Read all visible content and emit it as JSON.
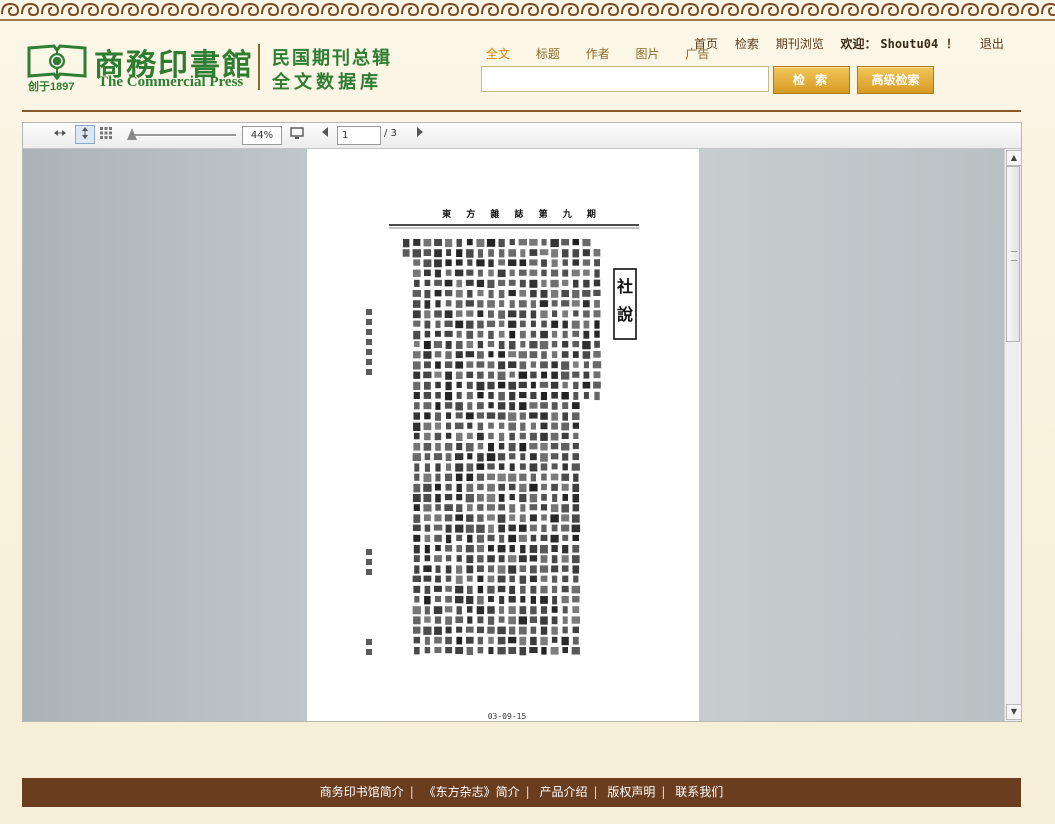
{
  "brand": {
    "logo_cn": "商務印書館",
    "logo_en": "The Commercial Press",
    "established": "创于1897",
    "db_title_line1": "民国期刊总辑",
    "db_title_line2": "全文数据库"
  },
  "top_nav": {
    "home": "首页",
    "search": "检索",
    "browse": "期刊浏览",
    "welcome": "欢迎：",
    "username": "Shoutu04",
    "exclaim": "！",
    "logout": "退出"
  },
  "search": {
    "tabs": [
      {
        "label": "全文",
        "active": true
      },
      {
        "label": "标题",
        "active": false
      },
      {
        "label": "作者",
        "active": false
      },
      {
        "label": "图片",
        "active": false
      },
      {
        "label": "广告",
        "active": false
      }
    ],
    "query": "",
    "search_button": "检 索",
    "advanced_button": "高级检索"
  },
  "viewer": {
    "toolbar": {
      "fit_width_icon": "fit-width-icon",
      "fit_page_icon": "fit-page-icon",
      "thumbnails_icon": "thumbnails-icon",
      "zoom_level": "44%",
      "fullscreen_icon": "monitor-icon",
      "prev_icon": "triangle-left-icon",
      "current_page": "1",
      "total_pages": "/ 3",
      "next_icon": "triangle-right-icon"
    },
    "zoom_fraction": 0.0,
    "document": {
      "running_header": "東 方 雜 誌 第 九 期",
      "column_label": "社說",
      "footer_code": "03-09-15"
    }
  },
  "footer": {
    "links": [
      "商务印书馆简介",
      "《东方杂志》简介",
      "产品介绍",
      "版权声明",
      "联系我们"
    ]
  },
  "colors": {
    "brand_green": "#2f7d32",
    "footer_brown": "#6b3d1f",
    "button_gold": "#e0aa34",
    "active_tab": "#d48a00"
  }
}
